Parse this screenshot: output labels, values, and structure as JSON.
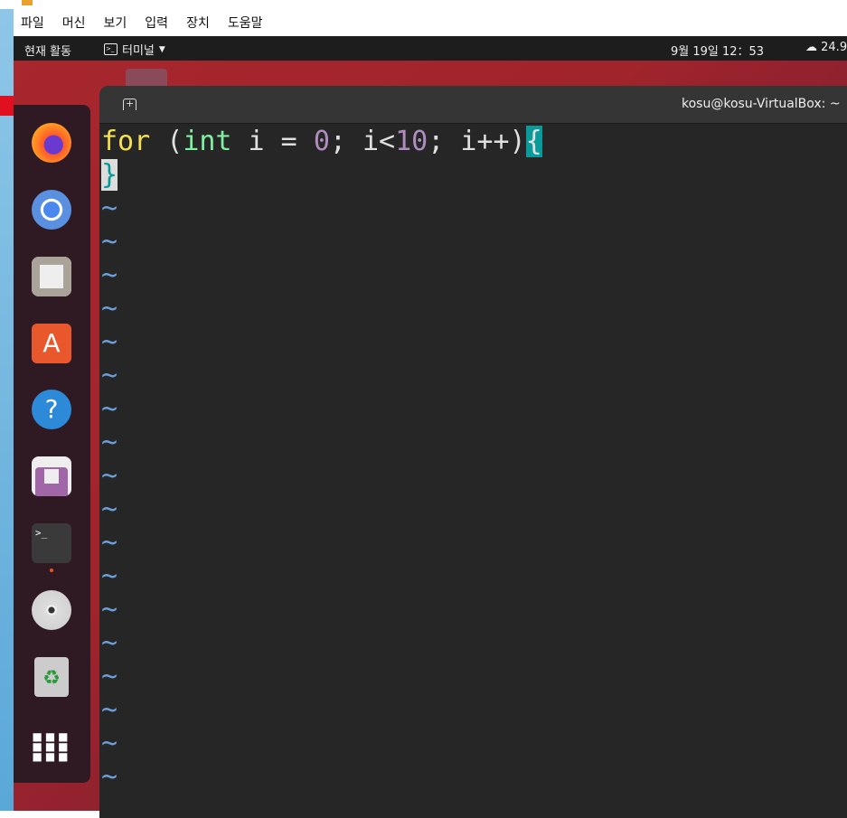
{
  "vbox_menu": [
    "파일",
    "머신",
    "보기",
    "입력",
    "장치",
    "도움말"
  ],
  "topbar": {
    "activities": "현재 활동",
    "app_menu": "터미널",
    "clock": "9월 19일  12：53",
    "weather": "24.9"
  },
  "dock": {
    "items": [
      "firefox",
      "chromium",
      "files",
      "app-center",
      "help",
      "settings",
      "terminal",
      "disc",
      "trash",
      "show-apps"
    ]
  },
  "terminal": {
    "title": "kosu@kosu-VirtualBox: ~",
    "code": {
      "kw": "for",
      "p1": " (",
      "type": "int",
      "mid": " i = ",
      "n0": "0",
      "mid2": "; i<",
      "n10": "10",
      "end": "; i++)",
      "open": "{",
      "close": "}"
    },
    "tilde": "~",
    "empty_lines": 18
  },
  "colors": {
    "keyword": "#f5e050",
    "type": "#7ef0a0",
    "number": "#b08cc0",
    "match_highlight": "#0a9a9a",
    "tilde": "#6ca0dc"
  }
}
